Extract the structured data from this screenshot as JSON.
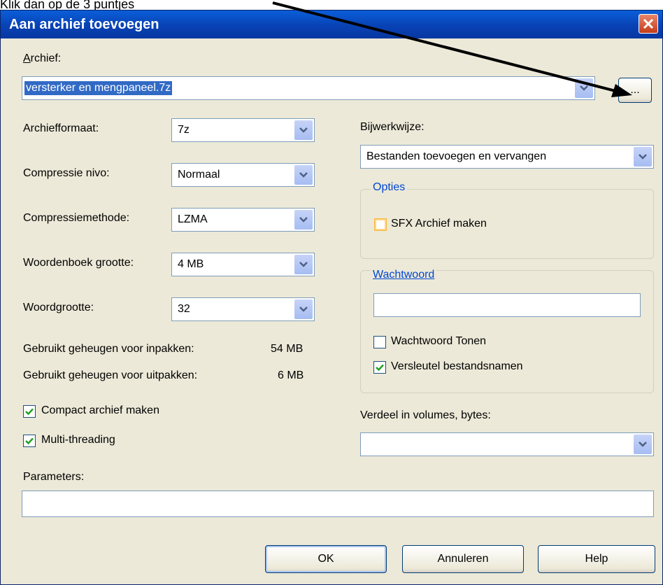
{
  "top_note": "Klik dan op de 3 puntjes",
  "dialog": {
    "title": "Aan archief toevoegen",
    "archive_label": "Archief:",
    "archive_value": "versterker en mengpaneel.7z",
    "browse_label": "..."
  },
  "left": {
    "format_label": "Archiefformaat:",
    "format_value": "7z",
    "level_label": "Compressie nivo:",
    "level_value": "Normaal",
    "method_label": "Compressiemethode:",
    "method_value": "LZMA",
    "dict_label": "Woordenboek grootte:",
    "dict_value": "4 MB",
    "word_label": "Woordgrootte:",
    "word_value": "32",
    "mem_pack_label": "Gebruikt geheugen voor inpakken:",
    "mem_pack_value": "54 MB",
    "mem_unpack_label": "Gebruikt geheugen voor uitpakken:",
    "mem_unpack_value": "6 MB",
    "solid_label": "Compact archief maken",
    "solid_checked": true,
    "mt_label": "Multi-threading",
    "mt_checked": true
  },
  "right": {
    "update_label": "Bijwerkwijze:",
    "update_value": "Bestanden toevoegen en vervangen",
    "options_title": "Opties",
    "sfx_label": "SFX Archief maken",
    "sfx_checked": false,
    "password_title": "Wachtwoord",
    "password_value": "",
    "show_pw_label": "Wachtwoord Tonen",
    "show_pw_checked": false,
    "encrypt_names_label": "Versleutel bestandsnamen",
    "encrypt_names_checked": true,
    "volumes_label": "Verdeel in volumes, bytes:",
    "volumes_value": ""
  },
  "params_label": "Parameters:",
  "params_value": "",
  "buttons": {
    "ok": "OK",
    "cancel": "Annuleren",
    "help": "Help"
  }
}
